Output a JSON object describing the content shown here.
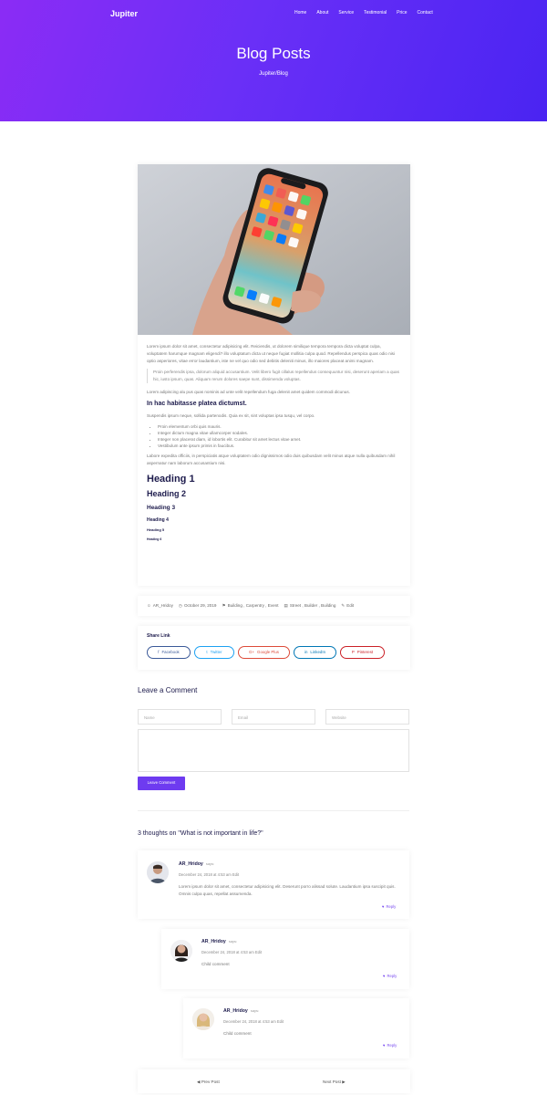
{
  "header": {
    "brand": "Jupiter",
    "nav": [
      "Home",
      "About",
      "Service",
      "Testimonial",
      "Price",
      "Contact"
    ],
    "title": "Blog Posts",
    "breadcrumb": "Jupiter/Blog"
  },
  "post": {
    "intro": "Lorem ipsum dolor sit amet, consectetur adipisicing elit. Reiciendis, ut dolorem similique tempora tempora dicta voluptat culpa, voluptatem harumque magnam eligendi? illo voluptatum dicta ut neque fugiat mollitia culpa quod. Repellendus perspica quas odio nisi optio asperiores, vitae error laudantium, iste ne vel quo odio sed debitis deleniti minus, illo maiores placeat animi magnam.",
    "quote": "Proin perferendis ipsa, dolorum aliquid accusantium. Velit libero fugit cillalus repellendus consequuntur nisi, deserunt aperiam a quas hic, iusto ipsum, quas. Aliquam rerum dolores saepe sunt, dissimenda voluptas.",
    "para2": "Lorem adipiscing alu pus quas nominis ad unte velit repellendum fuga delenit amet quidem commodi dicunus.",
    "subheading": "In hac habitasse platea dictumst.",
    "para3": "Suspendis ipsum neque, sollida partenodis. Quia ex sit, sint voluptas ipsa tusqu, vel corpo.",
    "list": [
      "Proin elementum orbi quis mauris.",
      "Integer dictum magna vitae ullamcorper sodales.",
      "Integer non placerat diam, id lobortis elit. Curabitur sit amet lectus vitae amet.",
      "Vestibulum ante ipsum primis in faucibus."
    ],
    "para4": "Labore expedita officiis, in perspiciatis atque voluptatem odio dignissimos odio duis quibusdam velit minus atque nulla quibusdam nihil aspernatur nam laborum accusantium nisi.",
    "headings": [
      "Heading 1",
      "Heading 2",
      "Heading 3",
      "Heading 4",
      "Heading 5",
      "Heading 6"
    ]
  },
  "meta": {
    "author": "AR_Hridoy",
    "date": "October 29, 2019",
    "tags": "Building , Carpentry , Event",
    "categories": "Street , Builder , Building",
    "edit": "Edit"
  },
  "share": {
    "title": "Share Link",
    "buttons": [
      {
        "label": "Facebook",
        "color": "#3b5998",
        "icon": "f"
      },
      {
        "label": "Twitter",
        "color": "#1da1f2",
        "icon": "t"
      },
      {
        "label": "Google Plus",
        "color": "#dd4b39",
        "icon": "G+"
      },
      {
        "label": "LinkedIn",
        "color": "#0077b5",
        "icon": "in"
      },
      {
        "label": "Pinterest",
        "color": "#cb2027",
        "icon": "P"
      }
    ]
  },
  "comment_form": {
    "heading": "Leave a Comment",
    "name_placeholder": "Name",
    "email_placeholder": "Email",
    "website_placeholder": "Website",
    "submit_label": "Leave Comment"
  },
  "comments": {
    "heading": "3 thoughts on \"What is not important in life?\"",
    "items": [
      {
        "name": "AR_Hridoy",
        "says": "says:",
        "date": "December 24, 2018 at 4:53 am Edit",
        "text": "Lorem ipsum dolor sit amet, consectetur adipisicing elit. Deserunt porro alissad solute. Laudantium ipsa suscipit quis. Omnis culpa quas, repellat assumenda.",
        "reply": "Reply"
      },
      {
        "name": "AR_Hridoy",
        "says": "says:",
        "date": "December 24, 2018 at 4:53 am Edit",
        "text": "Child comment",
        "reply": "Reply"
      },
      {
        "name": "AR_Hridoy",
        "says": "says:",
        "date": "December 24, 2018 at 4:53 am Edit",
        "text": "Child comment",
        "reply": "Reply"
      }
    ]
  },
  "pagination": {
    "prev": "Prev Post",
    "next": "Next Post"
  },
  "colors": {
    "accent": "#6e3bf0",
    "heading": "#1d1b4c"
  }
}
